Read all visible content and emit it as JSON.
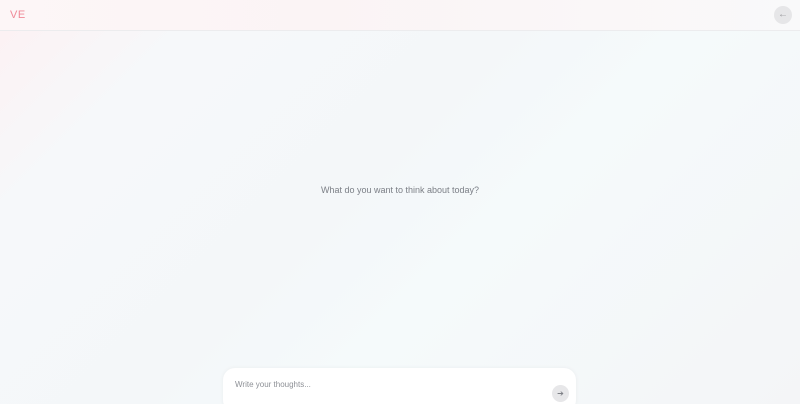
{
  "header": {
    "logo_text": "VE",
    "back_icon": "←"
  },
  "main": {
    "prompt": "What do you want to think about today?"
  },
  "composer": {
    "placeholder": "Write your thoughts...",
    "value": "",
    "send_icon": "➔"
  },
  "colors": {
    "logo": "#f08a98",
    "prompt_text": "#7b7f86",
    "button_bg": "#e7e7e9"
  }
}
